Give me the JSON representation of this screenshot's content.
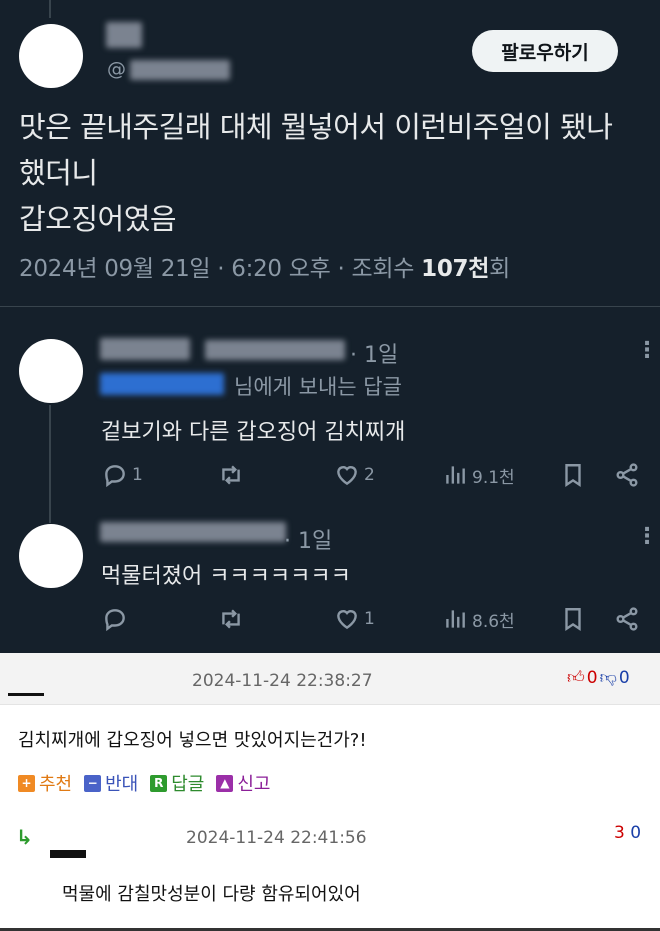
{
  "tweet": {
    "handle_at": "@",
    "follow_label": "팔로우하기",
    "text_lines": [
      "맛은 끝내주길래 대체 뭘넣어서 이런비주얼이 됐나",
      "했더니",
      "갑오징어였음"
    ],
    "meta_prefix": "2024년 09월 21일 · 6:20 오후 · 조회수 ",
    "views_bold": "107천",
    "views_suffix": "회"
  },
  "replies": [
    {
      "time": "· 1일",
      "reply_to_suffix": "님에게 보내는 답글",
      "text": "겉보기와 다른 갑오징어 김치찌개",
      "counts": {
        "reply": "1",
        "retweet": "",
        "like": "2",
        "views": "9.1천"
      }
    },
    {
      "time": "· 1일",
      "text": "먹물터졌어 ㅋㅋㅋㅋㅋㅋㅋ",
      "counts": {
        "reply": "",
        "retweet": "",
        "like": "1",
        "views": "8.6천"
      }
    }
  ],
  "comments": [
    {
      "date": "2024-11-24 22:38:27",
      "up": "0",
      "down": "0",
      "text": "김치찌개에 갑오징어 넣으면 맛있어지는건가?!",
      "buttons": {
        "recommend": "추천",
        "oppose": "반대",
        "reply": "답글",
        "report": "신고"
      }
    },
    {
      "date": "2024-11-24 22:41:56",
      "up": "3",
      "down": "0",
      "text": "먹물에 감칠맛성분이 다량 함유되어있어"
    }
  ],
  "colors": {
    "twitter_bg": "#15202b",
    "muted": "#8b98a5",
    "vote_up": "#cc0000",
    "vote_down": "#1a3fa8",
    "recommend": "#f08a24",
    "oppose": "#4a63c8",
    "reply_btn": "#2e9b2e",
    "report": "#9b2fa8"
  },
  "icons": [
    "reply-icon",
    "retweet-icon",
    "heart-icon",
    "views-icon",
    "bookmark-icon",
    "share-icon",
    "more-icon",
    "thumb-up-icon",
    "thumb-down-icon",
    "reply-arrow-icon"
  ]
}
